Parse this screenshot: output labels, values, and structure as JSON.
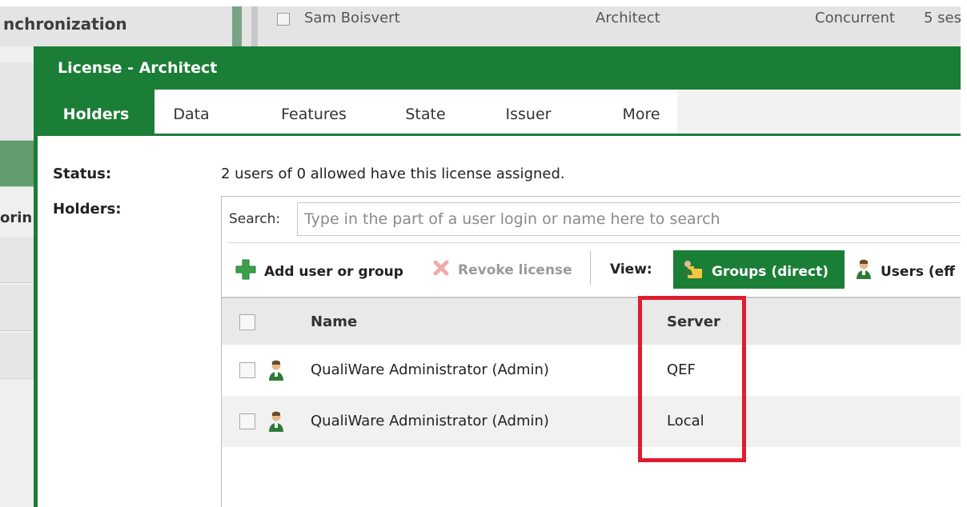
{
  "background": {
    "left_header": "nchronization",
    "row": {
      "name": "Sam Boisvert",
      "license": "Architect",
      "type": "Concurrent",
      "sessions": "5 ses"
    },
    "left_cut_label": "orin"
  },
  "modal": {
    "title": "License - Architect",
    "tabs": [
      {
        "label": "Holders",
        "active": true
      },
      {
        "label": "Data"
      },
      {
        "label": "Features"
      },
      {
        "label": "State"
      },
      {
        "label": "Issuer"
      },
      {
        "label": "More"
      }
    ],
    "status_label": "Status:",
    "status_text": "2 users of 0 allowed have this license assigned.",
    "holders_label": "Holders:",
    "search": {
      "label": "Search:",
      "placeholder": "Type in the part of a user login or name here to search"
    },
    "toolbar": {
      "add": "Add user or group",
      "revoke": "Revoke license",
      "view_label": "View:",
      "groups_direct": "Groups (direct)",
      "users_effective": "Users (eff"
    },
    "grid": {
      "columns": [
        "Name",
        "Server"
      ],
      "rows": [
        {
          "name": "QualiWare Administrator (Admin)",
          "server": "QEF"
        },
        {
          "name": "QualiWare Administrator (Admin)",
          "server": "Local"
        }
      ]
    }
  },
  "colors": {
    "brand_green": "#1b7e36",
    "highlight_red": "#e01c2f"
  },
  "icons": {
    "add": "plus-icon",
    "revoke": "x-icon",
    "groups": "group-folder-icon",
    "user": "user-icon"
  }
}
